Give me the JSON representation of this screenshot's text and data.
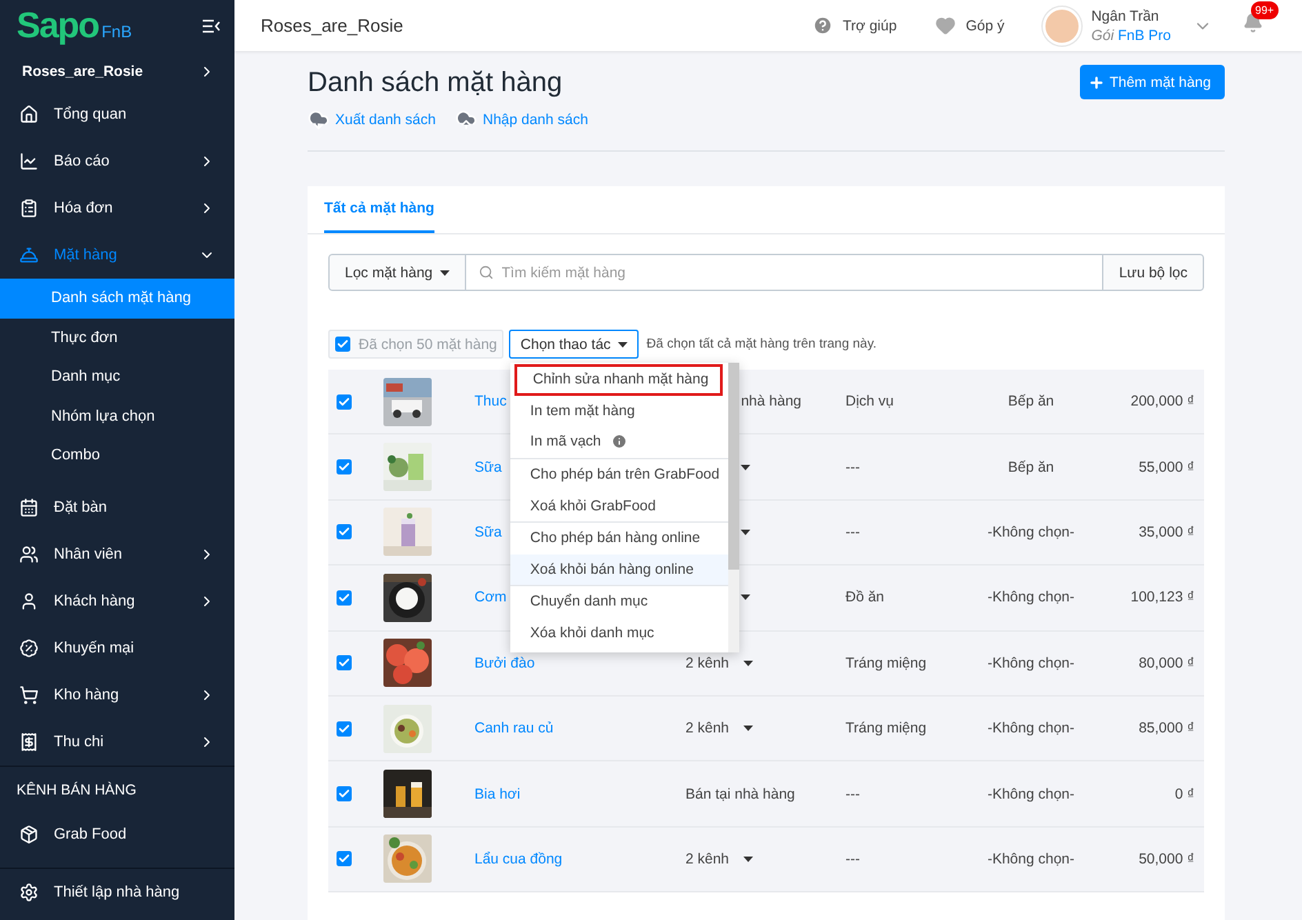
{
  "sidebar": {
    "logo": {
      "brand": "Sapo",
      "suffix": "FnB"
    },
    "store": "Roses_are_Rosie",
    "items": [
      {
        "label": "Tổng quan",
        "expandable": false,
        "expanded": false,
        "selected": false
      },
      {
        "label": "Báo cáo",
        "expandable": true,
        "expanded": false,
        "selected": false
      },
      {
        "label": "Hóa đơn",
        "expandable": true,
        "expanded": false,
        "selected": false
      },
      {
        "label": "Mặt hàng",
        "expandable": true,
        "expanded": true,
        "selected": true,
        "children": [
          {
            "label": "Danh sách mặt hàng",
            "selected": true
          },
          {
            "label": "Thực đơn",
            "selected": false
          },
          {
            "label": "Danh mục",
            "selected": false
          },
          {
            "label": "Nhóm lựa chọn",
            "selected": false
          },
          {
            "label": "Combo",
            "selected": false
          }
        ]
      },
      {
        "label": "Đặt bàn",
        "expandable": false,
        "expanded": false,
        "selected": false
      },
      {
        "label": "Nhân viên",
        "expandable": true,
        "expanded": false,
        "selected": false
      },
      {
        "label": "Khách hàng",
        "expandable": true,
        "expanded": false,
        "selected": false
      },
      {
        "label": "Khuyến mại",
        "expandable": false,
        "expanded": false,
        "selected": false
      },
      {
        "label": "Kho hàng",
        "expandable": true,
        "expanded": false,
        "selected": false
      },
      {
        "label": "Thu chi",
        "expandable": true,
        "expanded": false,
        "selected": false
      }
    ],
    "section_title": "KÊNH BÁN HÀNG",
    "channels": [
      {
        "label": "Grab Food"
      }
    ],
    "footer": "Thiết lập nhà hàng"
  },
  "topbar": {
    "title": "Roses_are_Rosie",
    "help": "Trợ giúp",
    "feedback": "Góp ý",
    "user": {
      "name": "Ngân Trần",
      "plan_label": "Gói",
      "plan": "FnB Pro"
    },
    "notifications": "99+"
  },
  "page": {
    "title": "Danh sách mặt hàng",
    "add_button": "Thêm mặt hàng",
    "links": [
      {
        "label": "Xuất danh sách"
      },
      {
        "label": "Nhập danh sách"
      }
    ]
  },
  "card": {
    "tabs": [
      {
        "label": "Tất cả mặt hàng",
        "selected": true
      }
    ],
    "filter": {
      "button": "Lọc mặt hàng",
      "placeholder": "Tìm kiếm mặt hàng",
      "save": "Lưu bộ lọc"
    },
    "bulk": {
      "checked": true,
      "count_label": "Đã chọn 50 mặt hàng",
      "action_button": "Chọn thao tác",
      "note": "Đã chọn tất cả mặt hàng trên trang này.",
      "menu_groups": [
        [
          {
            "label": "Chỉnh sửa nhanh mặt hàng",
            "focused": true,
            "hovered": false,
            "info": false
          },
          {
            "label": "In tem mặt hàng",
            "focused": false,
            "hovered": false,
            "info": false
          },
          {
            "label": "In mã vạch",
            "focused": false,
            "hovered": false,
            "info": true
          }
        ],
        [
          {
            "label": "Cho phép bán trên GrabFood",
            "focused": false,
            "hovered": false,
            "info": false
          },
          {
            "label": "Xoá khỏi GrabFood",
            "focused": false,
            "hovered": false,
            "info": false
          }
        ],
        [
          {
            "label": "Cho phép bán hàng online",
            "focused": false,
            "hovered": false,
            "info": false
          },
          {
            "label": "Xoá khỏi bán hàng online",
            "focused": false,
            "hovered": true,
            "info": false
          }
        ],
        [
          {
            "label": "Chuyển danh mục",
            "focused": false,
            "hovered": false,
            "info": false
          },
          {
            "label": "Xóa khỏi danh mục",
            "focused": false,
            "hovered": false,
            "info": false
          }
        ]
      ]
    },
    "rows": [
      {
        "checked": true,
        "name": "Thuc",
        "channel": {
          "kind": "text",
          "text": "nhà hàng",
          "cut": true
        },
        "type": "Dịch vụ",
        "kitchen": "Bếp ăn",
        "price": "200,000 ₫"
      },
      {
        "checked": true,
        "name": "Sữa",
        "channel": {
          "kind": "dropdown"
        },
        "type": "---",
        "kitchen": "Bếp ăn",
        "price": "55,000 ₫"
      },
      {
        "checked": true,
        "name": "Sữa",
        "channel": {
          "kind": "dropdown"
        },
        "type": "---",
        "kitchen": "-Không chọn-",
        "price": "35,000 ₫"
      },
      {
        "checked": true,
        "name": "Cơm",
        "channel": {
          "kind": "dropdown"
        },
        "type": "Đồ ăn",
        "kitchen": "-Không chọn-",
        "price": "100,123 ₫"
      },
      {
        "checked": true,
        "name": "Bưởi đào",
        "channel": {
          "kind": "dropdown",
          "text": "2 kênh"
        },
        "type": "Tráng miệng",
        "kitchen": "-Không chọn-",
        "price": "80,000 ₫"
      },
      {
        "checked": true,
        "name": "Canh rau củ",
        "channel": {
          "kind": "dropdown",
          "text": "2 kênh"
        },
        "type": "Tráng miệng",
        "kitchen": "-Không chọn-",
        "price": "85,000 ₫"
      },
      {
        "checked": true,
        "name": "Bia hơi",
        "channel": {
          "kind": "text",
          "text": "Bán tại nhà hàng",
          "cut": false
        },
        "type": "---",
        "kitchen": "-Không chọn-",
        "price": "0 ₫"
      },
      {
        "checked": true,
        "name": "Lẩu cua đồng",
        "channel": {
          "kind": "dropdown",
          "text": "2 kênh"
        },
        "type": "---",
        "kitchen": "-Không chọn-",
        "price": "50,000 ₫"
      }
    ]
  }
}
